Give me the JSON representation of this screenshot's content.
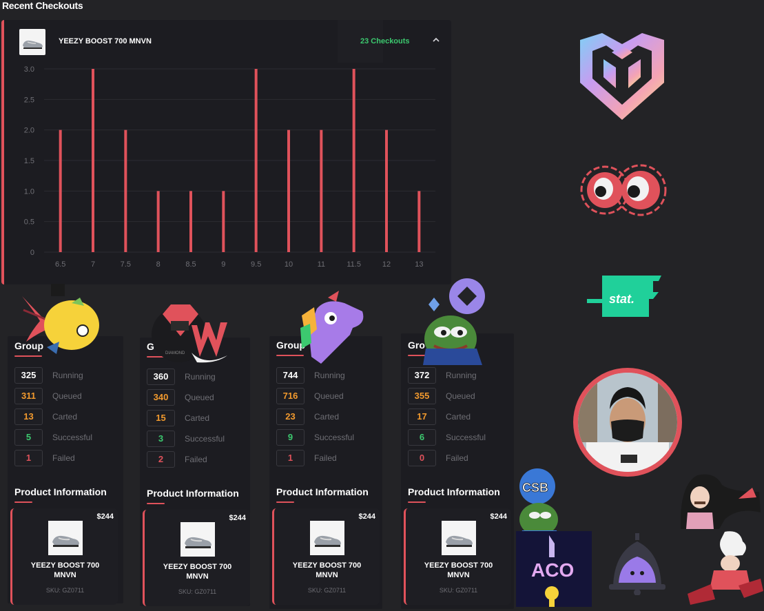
{
  "section_title": "Recent Checkouts",
  "checkout": {
    "product": "YEEZY BOOST 700 MNVN",
    "count_label": "23 Checkouts"
  },
  "chart_data": {
    "type": "bar",
    "categories": [
      "6.5",
      "7",
      "7.5",
      "8",
      "8.5",
      "9",
      "9.5",
      "10",
      "11",
      "11.5",
      "12",
      "13"
    ],
    "values": [
      2,
      3,
      2,
      1,
      1,
      1,
      3,
      2,
      2,
      3,
      2,
      1
    ],
    "ylim": [
      0,
      3
    ],
    "yticks": [
      "3.0",
      "2.5",
      "2.0",
      "1.5",
      "1.0",
      "0.5",
      "0"
    ],
    "grid": true,
    "colors": {
      "bar": "#e0525b",
      "grid": "#2c2c33",
      "axis_text": "#6f6f75"
    }
  },
  "groups": [
    {
      "title": "Group",
      "stats": [
        {
          "value": "325",
          "label": "Running"
        },
        {
          "value": "311",
          "label": "Queued"
        },
        {
          "value": "13",
          "label": "Carted"
        },
        {
          "value": "5",
          "label": "Successful"
        },
        {
          "value": "1",
          "label": "Failed"
        }
      ],
      "info_title": "Product Information",
      "product": {
        "price": "$244",
        "name": "YEEZY BOOST 700 MNVN",
        "sku": "SKU: GZ0711"
      }
    },
    {
      "title": "G",
      "stats": [
        {
          "value": "360",
          "label": "Running"
        },
        {
          "value": "340",
          "label": "Queued"
        },
        {
          "value": "15",
          "label": "Carted"
        },
        {
          "value": "3",
          "label": "Successful"
        },
        {
          "value": "2",
          "label": "Failed"
        }
      ],
      "info_title": "Product Information",
      "product": {
        "price": "$244",
        "name": "YEEZY BOOST 700 MNVN",
        "sku": "SKU: GZ0711"
      }
    },
    {
      "title": "Group",
      "stats": [
        {
          "value": "744",
          "label": "Running"
        },
        {
          "value": "716",
          "label": "Queued"
        },
        {
          "value": "23",
          "label": "Carted"
        },
        {
          "value": "9",
          "label": "Successful"
        },
        {
          "value": "1",
          "label": "Failed"
        }
      ],
      "info_title": "Product Information",
      "product": {
        "price": "$244",
        "name": "YEEZY BOOST 700 MNVN",
        "sku": "SKU: GZ0711"
      }
    },
    {
      "title": "Gro",
      "stats": [
        {
          "value": "372",
          "label": "Running"
        },
        {
          "value": "355",
          "label": "Queued"
        },
        {
          "value": "17",
          "label": "Carted"
        },
        {
          "value": "6",
          "label": "Successful"
        },
        {
          "value": "0",
          "label": "Failed"
        }
      ],
      "info_title": "Product Information",
      "product": {
        "price": "$244",
        "name": "YEEZY BOOST 700 MNVN",
        "sku": "SKU: GZ0711"
      }
    }
  ],
  "logos": {
    "stat": "stat.",
    "csb": "CSB",
    "aco": "ACO",
    "diamond": "DIAMOND",
    "w": "W"
  },
  "colors": {
    "accent": "#e0525b",
    "green": "#3cc96f",
    "orange": "#f29a2e",
    "stat_bg": "#20d09a"
  }
}
